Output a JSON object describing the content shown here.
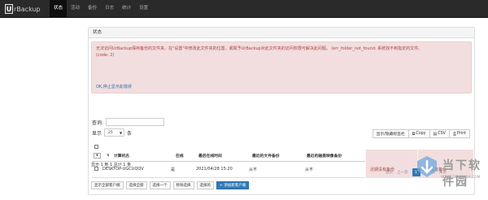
{
  "app": {
    "brand_letter": "U",
    "brand_name": "rBackup"
  },
  "nav": {
    "items": [
      "状态",
      "活动",
      "备份",
      "日志",
      "统计",
      "设置"
    ],
    "active_index": 0
  },
  "panel": {
    "title": "状态"
  },
  "alert": {
    "line1": "无法访问UrBackup保存备份的文件夹。在\"设置\"中修改此文件夹的位置，或赋予UrBackup对此文件夹的访问权限可解决此问题。 (err_folder_not_found: 系统找不到指定的文件。",
    "line2": "(code: 2)",
    "link": "OK,停止显示此错误"
  },
  "search": {
    "label": "查询:",
    "value": ""
  },
  "length": {
    "prefix": "显示",
    "value": "25",
    "suffix": "条"
  },
  "table_buttons": {
    "colvis": "显示/隐藏标签栏",
    "copy": "Copy",
    "csv": "CSV",
    "print": "Print"
  },
  "table": {
    "columns": [
      "计算机名",
      "在线",
      "最后在线时间",
      "最近的文件备份",
      "最近的磁盘映像备份",
      "文件备份状态",
      "磁盘映像备份状态"
    ],
    "rows": [
      {
        "name": "DESKTOP-UGCUQQV",
        "online": "是",
        "last_seen": "2021/04/28 15:20",
        "last_file_backup": "从不",
        "last_image_backup": "从不",
        "file_status": "近期没有备份",
        "image_status": "近期没有备份"
      }
    ]
  },
  "info": "显示 1 到 1 总计 1 条",
  "pagination": {
    "prev": "上一页",
    "current": "1",
    "next": "下一页",
    "first": "首页",
    "last": "末页"
  },
  "actions": [
    "显示全部客户端",
    "选择全部",
    "选择一个",
    "移除选择",
    "选择的",
    "+ 添加新客户端"
  ],
  "watermark": {
    "title": "当下软件园",
    "url": "WWW.DOWNXIA.COM"
  },
  "colors": {
    "navbar": "#2a2a2a",
    "alert_bg": "#f2dede",
    "alert_text": "#a94442",
    "primary": "#337ab7"
  }
}
